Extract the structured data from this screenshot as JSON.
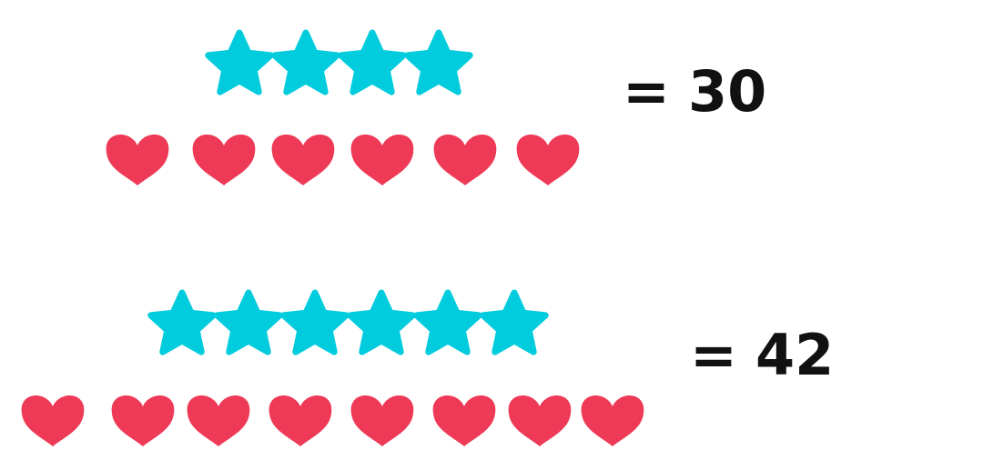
{
  "colors": {
    "star": "#00CCDD",
    "heart": "#EE3A57",
    "text": "#111111",
    "background": "#FFFFFF"
  },
  "icons": {
    "star": "star-icon",
    "heart": "heart-icon"
  },
  "equations": [
    {
      "stars": 4,
      "hearts": 6,
      "sign": "=",
      "result": "30"
    },
    {
      "stars": 6,
      "hearts": 8,
      "sign": "=",
      "result": "42"
    }
  ]
}
